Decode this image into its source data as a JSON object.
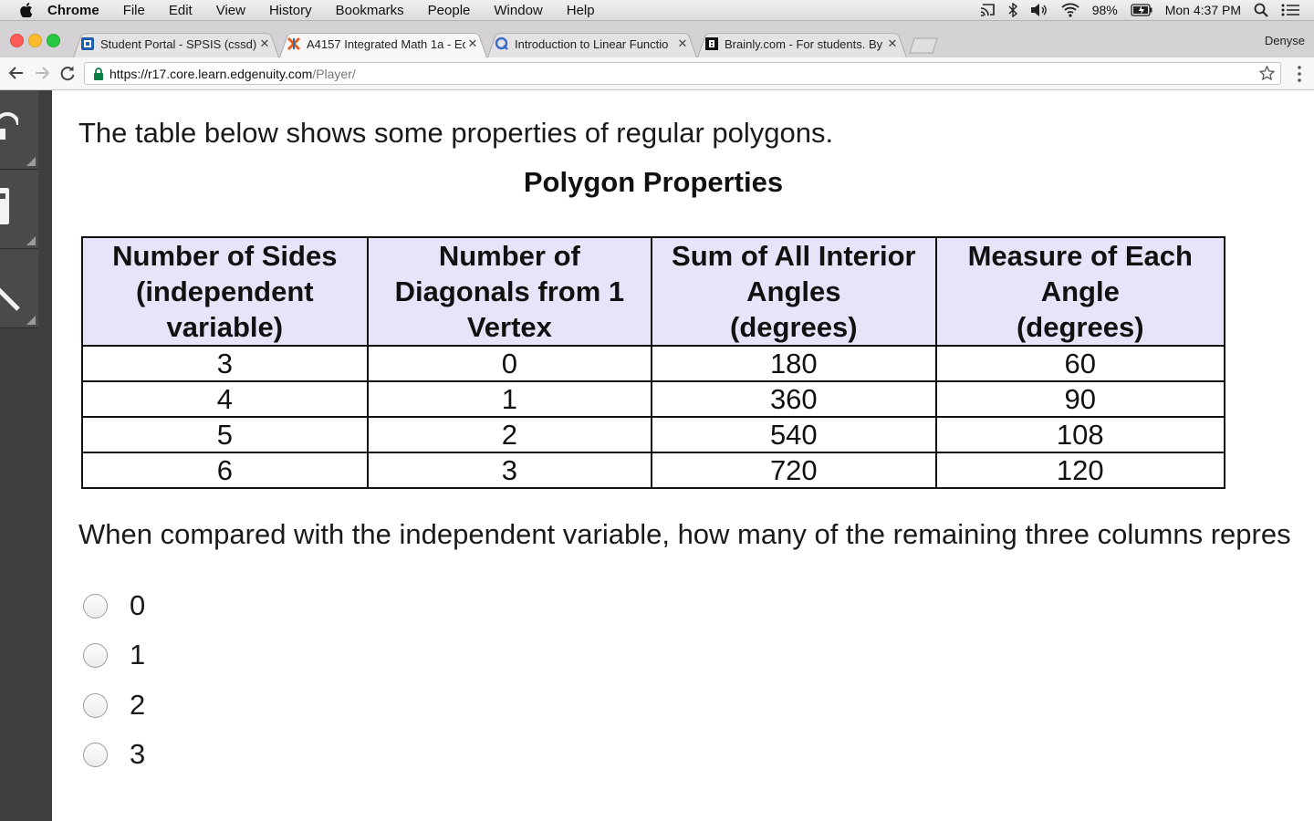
{
  "menubar": {
    "app": "Chrome",
    "items": [
      "File",
      "Edit",
      "View",
      "History",
      "Bookmarks",
      "People",
      "Window",
      "Help"
    ],
    "battery": "98%",
    "clock": "Mon 4:37 PM"
  },
  "tabs": [
    {
      "title": "Student Portal - SPSIS (cssd)",
      "icon": "portal-favicon"
    },
    {
      "title": "A4157 Integrated Math 1a - Ed",
      "icon": "edgenuity-favicon",
      "active": true
    },
    {
      "title": "Introduction to Linear Functio",
      "icon": "quizlet-favicon"
    },
    {
      "title": "Brainly.com - For students. By",
      "icon": "brainly-favicon"
    }
  ],
  "profile_name": "Denyse",
  "url": {
    "host": "https://r17.core.learn.edgenuity.com",
    "path": "/Player/"
  },
  "content": {
    "intro": "The table below shows some properties of regular polygons.",
    "table_title": "Polygon Properties",
    "headers": [
      [
        "Number of Sides",
        "(independent",
        "variable)"
      ],
      [
        "Number of",
        "Diagonals from 1",
        "Vertex"
      ],
      [
        "Sum of All Interior",
        "Angles",
        "(degrees)"
      ],
      [
        "Measure of Each",
        "Angle",
        "(degrees)"
      ]
    ],
    "rows": [
      [
        "3",
        "0",
        "180",
        "60"
      ],
      [
        "4",
        "1",
        "360",
        "90"
      ],
      [
        "5",
        "2",
        "540",
        "108"
      ],
      [
        "6",
        "3",
        "720",
        "120"
      ]
    ],
    "question": "When compared with the independent variable, how many of the remaining three columns repres",
    "options": [
      "0",
      "1",
      "2",
      "3"
    ]
  },
  "colors": {
    "header_fill": "#e6e4f8",
    "sidebar": "#3e3e3e"
  }
}
